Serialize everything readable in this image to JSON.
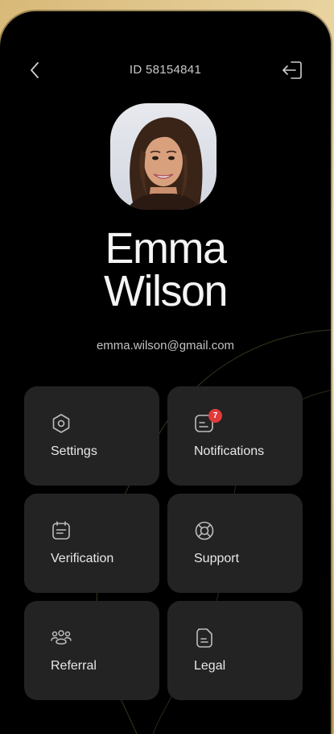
{
  "header": {
    "user_id": "ID 58154841",
    "back_icon": "chevron-left-icon",
    "logout_icon": "logout-icon"
  },
  "profile": {
    "first_name": "Emma",
    "last_name": "Wilson",
    "email": "emma.wilson@gmail.com"
  },
  "menu": {
    "items": [
      {
        "label": "Settings",
        "icon": "settings-icon"
      },
      {
        "label": "Notifications",
        "icon": "notifications-icon",
        "badge": "7"
      },
      {
        "label": "Verification",
        "icon": "verification-icon"
      },
      {
        "label": "Support",
        "icon": "support-icon"
      },
      {
        "label": "Referral",
        "icon": "referral-icon"
      },
      {
        "label": "Legal",
        "icon": "legal-icon"
      }
    ]
  },
  "colors": {
    "background": "#000000",
    "tile": "#232323",
    "badge": "#e23a3a",
    "frame_gold": "#e9d3a0"
  }
}
